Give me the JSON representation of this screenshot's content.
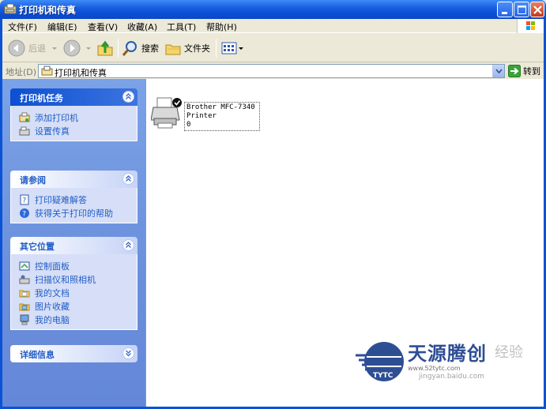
{
  "window": {
    "title": "打印机和传真"
  },
  "menu": {
    "items": [
      "文件(F)",
      "编辑(E)",
      "查看(V)",
      "收藏(A)",
      "工具(T)",
      "帮助(H)"
    ]
  },
  "toolbar": {
    "back_label": "后退",
    "search_label": "搜索",
    "folders_label": "文件夹"
  },
  "address": {
    "label": "地址(D)",
    "value": "打印机和传真",
    "go_label": "转到"
  },
  "taskpane": {
    "printer_tasks": {
      "title": "打印机任务",
      "items": [
        "添加打印机",
        "设置传真"
      ]
    },
    "see_also": {
      "title": "请参阅",
      "items": [
        "打印疑难解答",
        "获得关于打印的帮助"
      ]
    },
    "other_places": {
      "title": "其它位置",
      "items": [
        "控制面板",
        "扫描仪和照相机",
        "我的文档",
        "图片收藏",
        "我的电脑"
      ]
    },
    "details": {
      "title": "详细信息"
    }
  },
  "content": {
    "printer_name_line1": "Brother MFC-7340",
    "printer_name_line2": "Printer",
    "printer_status": "0"
  },
  "watermark": {
    "brand_cn": "天源腾创",
    "brand_abbr": "TYTC",
    "url": "www.52tytc.com",
    "site": "jingyan.baidu.com",
    "exp": "经验"
  },
  "colors": {
    "titlebar": "#0a53d6",
    "taskpane_bg": "#6b8fdc",
    "link": "#215dc6"
  }
}
